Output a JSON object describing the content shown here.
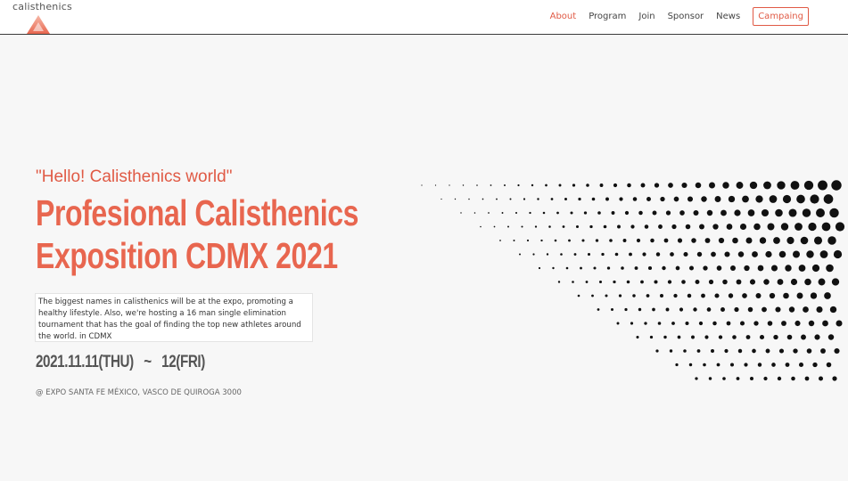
{
  "nav": {
    "logo_text": "calisthenics",
    "links": [
      {
        "label": "About",
        "active": true
      },
      {
        "label": "Program",
        "active": false
      },
      {
        "label": "Join",
        "active": false
      },
      {
        "label": "Sponsor",
        "active": false
      },
      {
        "label": "News",
        "active": false
      }
    ],
    "campaign_label": "Campaing"
  },
  "hero": {
    "eyebrow": "\"Hello! Calisthenics world\"",
    "headline_line1": "Profesional Calisthenics",
    "headline_line2": "Exposition CDMX 2021",
    "description": "The biggest names in calisthenics will be at the expo, promoting a healthy lifestyle. Also, we're hosting a 16 man single elimination tournament that has the goal of finding the top new athletes around the world. in CDMX",
    "dates": "2021.11.11(THU)   ~   12(FRI)",
    "venue": "@ EXPO SANTA FE MÉXICO, VASCO DE QUIROGA 3000"
  },
  "icons": {
    "logo": "triangle-logo-icon",
    "decoration": "halftone-dots-graphic"
  },
  "colors": {
    "accent": "#e05a45",
    "headline": "#e8664f",
    "background": "#f7f7f7",
    "nav_background": "#ffffff",
    "dots": "#111111"
  }
}
